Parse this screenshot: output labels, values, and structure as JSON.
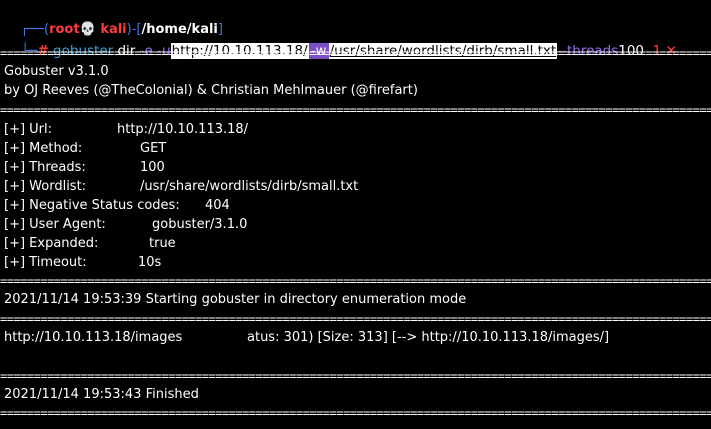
{
  "prompt": {
    "corner_top": "┌──(",
    "user": "root",
    "skull": "💀",
    "host": "kali",
    "mid": ")-[",
    "path": "/home/kali",
    "end": "]",
    "corner_bottom": "└─",
    "hash": "#",
    "cmd": "gobuster",
    "arg_dir": "dir",
    "arg_e": "-e",
    "arg_u": "-u",
    "url": "http://10.10.113.18/",
    "arg_w": "-w",
    "wordlist": "/usr/share/wordlists/dirb/small.txt",
    "arg_threads": "--threads",
    "threads": "100",
    "exit_code": "1",
    "exit_icon": "✕"
  },
  "banner": {
    "line1": "Gobuster v3.1.0",
    "line2": "by OJ Reeves (@TheColonial) & Christian Mehlmauer (@firefart)"
  },
  "config": [
    {
      "label": "[+] Url:",
      "value": "http://10.10.113.18/"
    },
    {
      "label": "[+] Method:",
      "value": "GET"
    },
    {
      "label": "[+] Threads:",
      "value": "100"
    },
    {
      "label": "[+] Wordlist:",
      "value": "/usr/share/wordlists/dirb/small.txt"
    },
    {
      "label": "[+] Negative Status codes:",
      "value": "404"
    },
    {
      "label": "[+] User Agent:",
      "value": "gobuster/3.1.0"
    },
    {
      "label": "[+] Expanded:",
      "value": "true"
    },
    {
      "label": "[+] Timeout:",
      "value": "10s"
    }
  ],
  "start_msg": "2021/11/14 19:53:39 Starting gobuster in directory enumeration mode",
  "result": {
    "path": "http://10.10.113.18/images",
    "status": "atus: 301) [Size: 313] [--> http://10.10.113.18/images/]"
  },
  "finish_msg": "2021/11/14 19:53:43 Finished",
  "separator": "======================================================================================================================"
}
